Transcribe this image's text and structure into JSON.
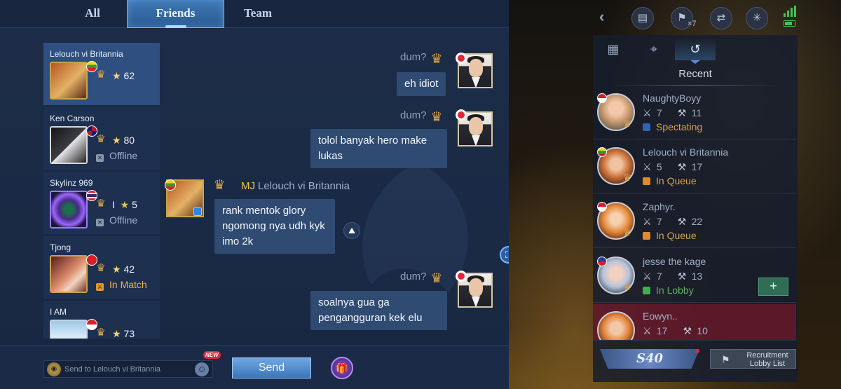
{
  "tabs": {
    "all": "All",
    "friends": "Friends",
    "team": "Team"
  },
  "friends": [
    {
      "name": "Lelouch vi Britannia",
      "stars": "62",
      "status": ""
    },
    {
      "name": "Ken Carson",
      "stars": "80",
      "status": "Offline"
    },
    {
      "name": "Skylinz 969",
      "stars": "5",
      "rank_numeral": "I",
      "status": "Offline"
    },
    {
      "name": "Tjong",
      "stars": "42",
      "status": "In Match"
    },
    {
      "name": "I AM",
      "stars": "73",
      "status": ""
    }
  ],
  "messages": [
    {
      "sender": "dum?",
      "text": "eh idiot"
    },
    {
      "sender": "dum?",
      "text_line1": "tolol banyak hero make",
      "text_line2": "lukas"
    },
    {
      "vip": "MJ",
      "sender": "Lelouch vi Britannia",
      "text_line1": "rank mentok glory",
      "text_line2": "ngomong nya udh kyk",
      "text_line3": "imo 2k"
    },
    {
      "sender": "dum?",
      "text_line1": "soalnya gua ga",
      "text_line2": "pengangguran kek elu"
    }
  ],
  "composer": {
    "placeholder": "Send to Lelouch vi Britannia",
    "new_tag": "NEW",
    "send_label": "Send"
  },
  "top_bar": {
    "multiplier": "×7"
  },
  "recent": {
    "label": "Recent",
    "players": [
      {
        "name": "NaughtyBoyy",
        "kills": "7",
        "games": "11",
        "status": "Spectating"
      },
      {
        "name": "Lelouch vi Britannia",
        "kills": "5",
        "games": "17",
        "status": "In Queue"
      },
      {
        "name": "Zaphyr.",
        "kills": "7",
        "games": "22",
        "status": "In Queue"
      },
      {
        "name": "jesse the kage",
        "kills": "7",
        "games": "13",
        "status": "In Lobby"
      },
      {
        "name": "Eowyn..",
        "kills": "17",
        "games": "10",
        "status": ""
      }
    ]
  },
  "invite_label": "+",
  "rank_banner": "S40",
  "recruitment_label": "Recruitment Lobby List",
  "colors": {
    "accent": "#3c75b8",
    "queue": "#d8a24a",
    "lobby": "#5fb15f",
    "tab_active": "#2a5a92"
  },
  "icons": [
    "back-arrow-icon",
    "card-icon",
    "emblem-icon",
    "share-icon",
    "network-icon",
    "grid-icon",
    "location-icon",
    "history-icon",
    "swords-icon",
    "hammer-icon",
    "gift-icon",
    "emoji-icon",
    "flag-icon",
    "screenshot-icon",
    "translate-icon"
  ]
}
